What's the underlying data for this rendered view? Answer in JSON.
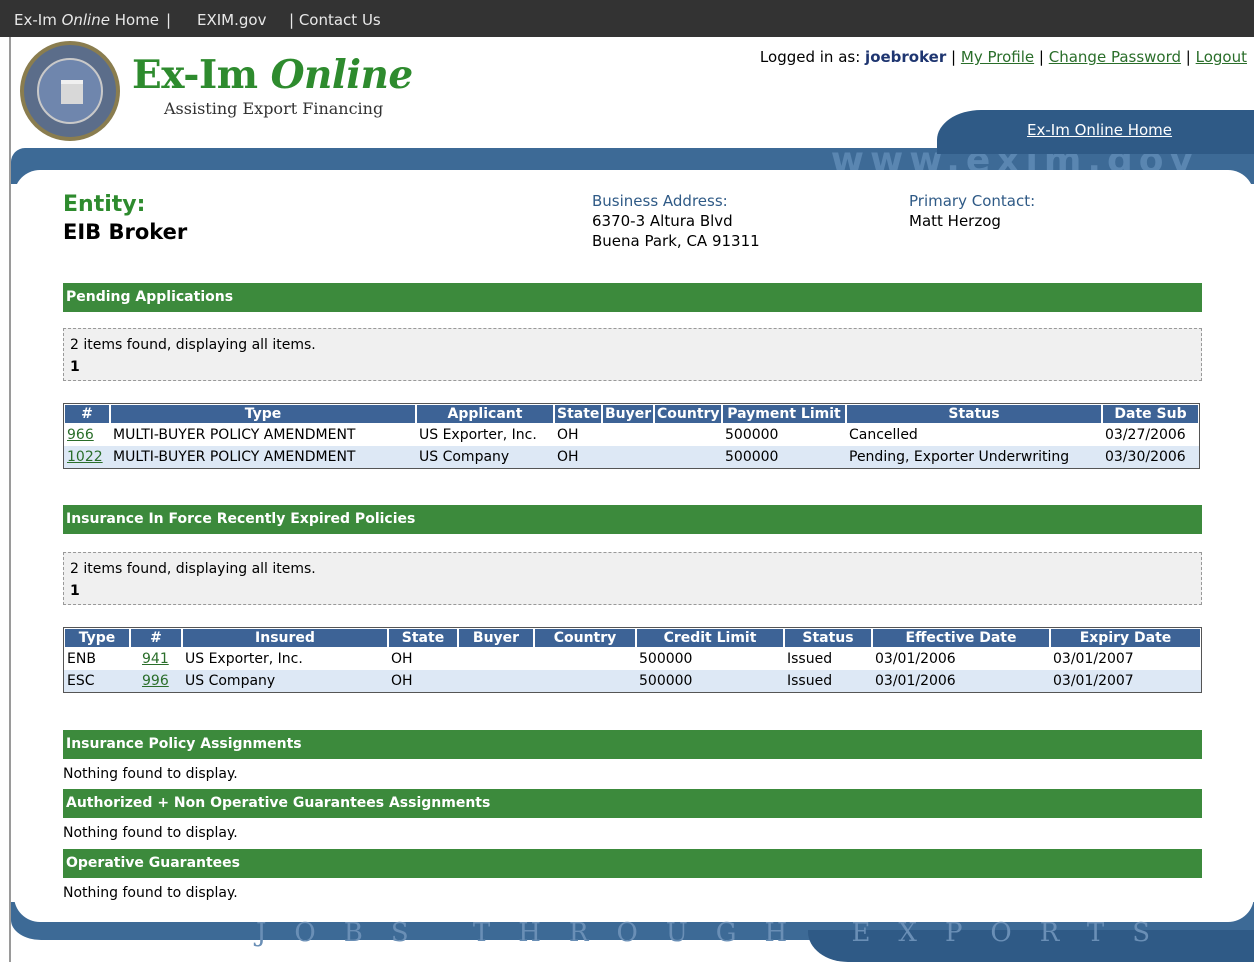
{
  "topbar": {
    "home_prefix": "Ex-Im ",
    "home_italic": "Online",
    "home_suffix": " Home",
    "sep1": "|",
    "exim": "EXIM.gov",
    "contact": "| Contact Us"
  },
  "header": {
    "logo_title_plain": "Ex-Im ",
    "logo_title_italic": "Online",
    "logo_subtitle": "Assisting Export Financing",
    "logged_in_label": "Logged in as:",
    "username": "joebroker",
    "sep": "|",
    "my_profile": "My Profile",
    "change_password": "Change Password",
    "logout": "Logout",
    "home_tab": "Ex-Im Online Home",
    "band_watermark": "www.exim.gov",
    "bottom_watermark": "JOBS THROUGH EXPORTS"
  },
  "entity": {
    "label": "Entity:",
    "name": "EIB Broker",
    "address_label": "Business Address:",
    "address_line1": "6370-3 Altura Blvd",
    "address_line2": "Buena Park, CA 91311",
    "contact_label": "Primary Contact:",
    "contact_name": "Matt Herzog"
  },
  "pending": {
    "title": "Pending Applications",
    "paging_text": "2 items found, displaying all items.",
    "page": "1",
    "columns": [
      "#",
      "Type",
      "Applicant",
      "State",
      "Buyer",
      "Country",
      "Payment Limit",
      "Status",
      "Date Sub"
    ],
    "rows": [
      {
        "num": "966",
        "type": "MULTI-BUYER POLICY AMENDMENT",
        "applicant": "US Exporter, Inc.",
        "state": "OH",
        "buyer": "",
        "country": "",
        "limit": "500000",
        "status": "Cancelled",
        "date": "03/27/2006"
      },
      {
        "num": "1022",
        "type": "MULTI-BUYER POLICY AMENDMENT",
        "applicant": "US Company",
        "state": "OH",
        "buyer": "",
        "country": "",
        "limit": "500000",
        "status": "Pending, Exporter Underwriting",
        "date": "03/30/2006"
      }
    ]
  },
  "inforce": {
    "title": "Insurance In Force Recently Expired Policies",
    "paging_text": "2 items found, displaying all items.",
    "page": "1",
    "columns": [
      "Type",
      "#",
      "Insured",
      "State",
      "Buyer",
      "Country",
      "Credit Limit",
      "Status",
      "Effective Date",
      "Expiry Date"
    ],
    "rows": [
      {
        "type": "ENB",
        "num": "941",
        "insured": "US Exporter, Inc.",
        "state": "OH",
        "buyer": "",
        "country": "",
        "limit": "500000",
        "status": "Issued",
        "effective": "03/01/2006",
        "expiry": "03/01/2007"
      },
      {
        "type": "ESC",
        "num": "996",
        "insured": "US Company",
        "state": "OH",
        "buyer": "",
        "country": "",
        "limit": "500000",
        "status": "Issued",
        "effective": "03/01/2006",
        "expiry": "03/01/2007"
      }
    ]
  },
  "assignments": {
    "title": "Insurance Policy Assignments",
    "empty": "Nothing found to display."
  },
  "guarantee_assignments": {
    "title": "Authorized + Non Operative Guarantees Assignments",
    "empty": "Nothing found to display."
  },
  "operative": {
    "title": "Operative Guarantees",
    "empty": "Nothing found to display."
  },
  "colors": {
    "topbar": "#333333",
    "brand_green": "#2e8b2e",
    "section_green": "#3c8a3c",
    "header_blue": "#3d6396",
    "band_blue": "#3d6a96",
    "row_alt": "#dde8f5"
  }
}
